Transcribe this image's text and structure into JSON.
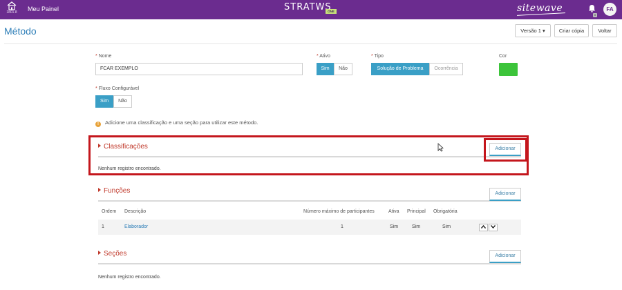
{
  "topbar": {
    "home_version": "1801.8",
    "meu_painel": "Meu Painel",
    "brand": "STRATWS",
    "brand_suffix": "ONE",
    "partner_logo": "sitewave",
    "avatar_initials": "FA",
    "bell_icon": "bell-icon"
  },
  "header": {
    "title": "Método",
    "versao_label": "Versão 1",
    "criar_copia_label": "Criar cópia",
    "voltar_label": "Voltar"
  },
  "form": {
    "nome_label": "Nome",
    "nome_value": "FCAR EXEMPLO",
    "ativo_label": "Ativo",
    "ativo_options": [
      "Sim",
      "Não"
    ],
    "ativo_selected": "Sim",
    "tipo_label": "Tipo",
    "tipo_options": [
      "Solução de Problema",
      "Ocorrência"
    ],
    "tipo_selected": "Solução de Problema",
    "cor_label": "Cor",
    "cor_value": "#3cc43a",
    "fluxo_label": "Fluxo Configurável",
    "fluxo_options": [
      "Sim",
      "Não"
    ],
    "fluxo_selected": "Sim",
    "required_marker": "*"
  },
  "info_message": "Adicione uma classificação e uma seção para utilizar este método.",
  "classificacoes": {
    "title": "Classificações",
    "add_label": "Adicionar",
    "empty_text": "Nenhum registro encontrado."
  },
  "funcoes": {
    "title": "Funções",
    "add_label": "Adicionar",
    "columns": [
      "Ordem",
      "Descrição",
      "Número máximo de participantes",
      "Ativa",
      "Principal",
      "Obrigatória"
    ],
    "rows": [
      {
        "ordem": "1",
        "descricao": "Elaborador",
        "max": "1",
        "ativa": "Sim",
        "principal": "Sim",
        "obrigatoria": "Sim"
      }
    ]
  },
  "secoes": {
    "title": "Seções",
    "add_label": "Adicionar",
    "empty_text": "Nenhum registro encontrado."
  },
  "colors": {
    "topbar": "#6b2c8f",
    "accent": "#3a9fc6",
    "section_title": "#c0392b",
    "highlight": "#c4161c"
  }
}
